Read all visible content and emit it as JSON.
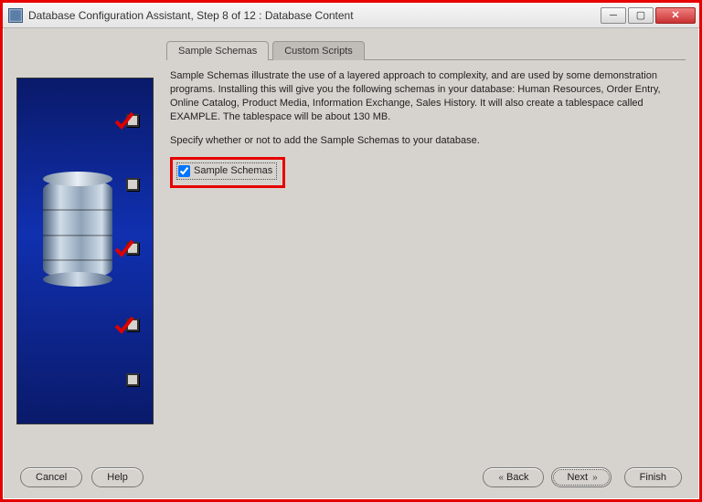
{
  "window": {
    "title": "Database Configuration Assistant, Step 8 of 12 : Database Content"
  },
  "tabs": {
    "sample": "Sample Schemas",
    "custom": "Custom Scripts"
  },
  "description": "Sample Schemas illustrate the use of a layered approach to complexity, and are used by some demonstration programs. Installing this will give you the following schemas in your database: Human Resources, Order Entry, Online Catalog, Product Media, Information Exchange, Sales History. It will also create a tablespace called EXAMPLE. The tablespace will be about 130 MB.",
  "instruction": "Specify whether or not to add the Sample Schemas to your database.",
  "checkbox": {
    "label": "Sample Schemas",
    "checked": true
  },
  "buttons": {
    "cancel": "Cancel",
    "help": "Help",
    "back": "Back",
    "next": "Next",
    "finish": "Finish"
  },
  "sidebar": {
    "steps": [
      {
        "checked": true
      },
      {
        "checked": false
      },
      {
        "checked": true
      },
      {
        "checked": true
      },
      {
        "checked": false
      }
    ]
  }
}
